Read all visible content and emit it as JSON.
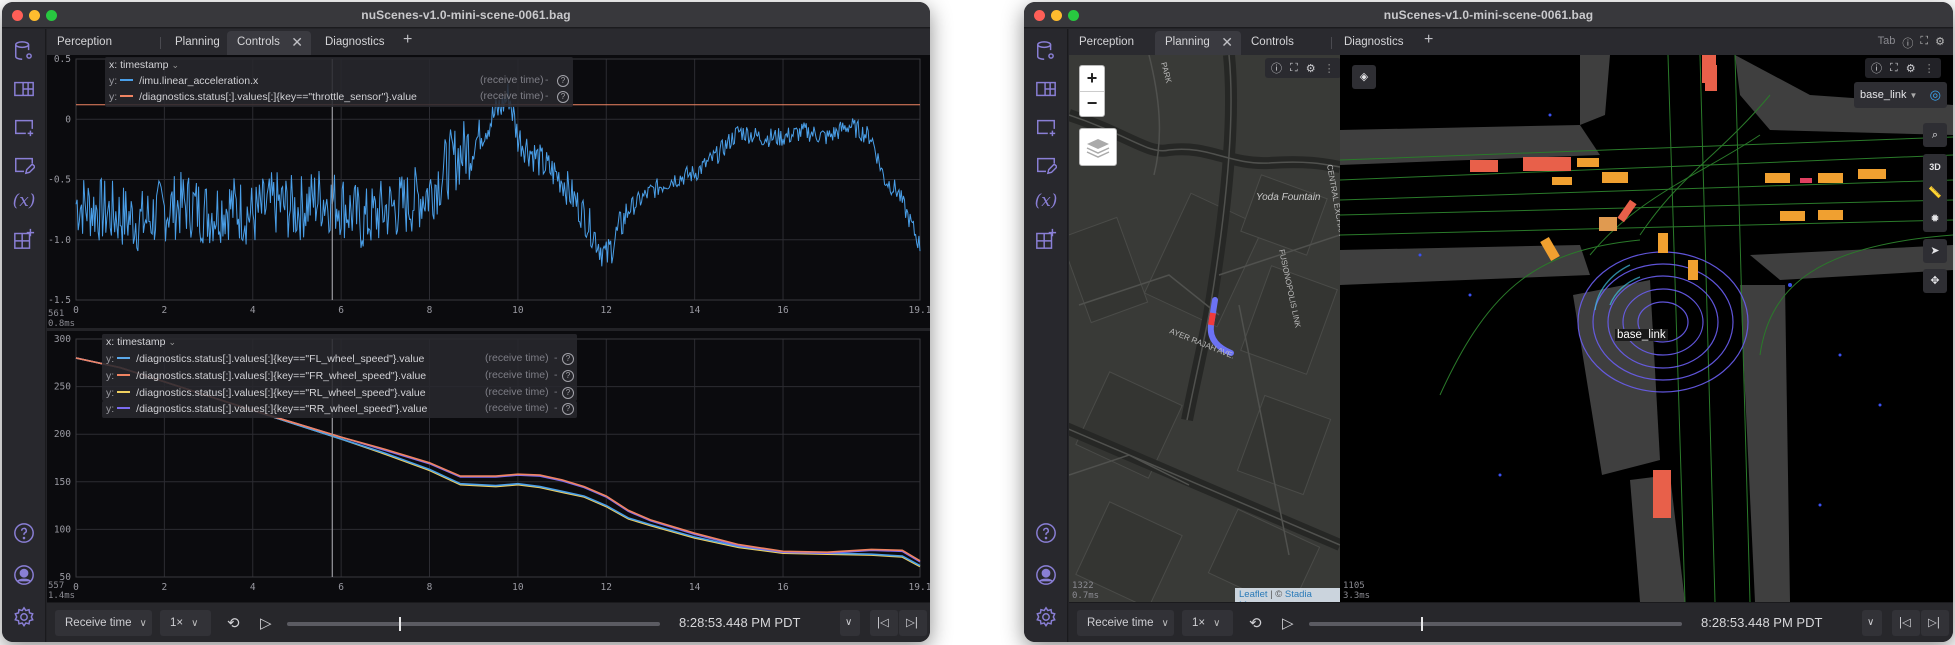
{
  "window_title": "nuScenes-v1.0-mini-scene-0061.bag",
  "sidebar": {
    "top_icons": [
      "data-source-icon",
      "layout-icon",
      "add-panel-icon",
      "edit-panel-icon",
      "variables-icon",
      "extensions-icon"
    ],
    "bottom_icons": [
      "help-icon",
      "user-icon",
      "settings-icon"
    ]
  },
  "left_window": {
    "tabs": [
      {
        "label": "Perception",
        "active": false
      },
      {
        "label": "Planning",
        "active": false
      },
      {
        "label": "Controls",
        "active": true
      },
      {
        "label": "Diagnostics",
        "active": false
      }
    ],
    "plot_top": {
      "x_selector": "x: timestamp",
      "series": [
        {
          "prefix": "y:",
          "path": "/imu.linear_acceleration.x",
          "time": "(receive time)",
          "color": "#4a9fe8"
        },
        {
          "prefix": "y:",
          "path": "/diagnostics.status[:].values[:]{key==\"throttle_sensor\"}.value",
          "time": "(receive time)",
          "color": "#f08462"
        }
      ],
      "dash": "-",
      "help": "?",
      "stat_count": "561",
      "stat_time": "0.8ms"
    },
    "plot_bottom": {
      "x_selector": "x: timestamp",
      "series": [
        {
          "prefix": "y:",
          "path": "/diagnostics.status[:].values[:]{key==\"FL_wheel_speed\"}.value",
          "time": "(receive time)",
          "color": "#5ba8e8"
        },
        {
          "prefix": "y:",
          "path": "/diagnostics.status[:].values[:]{key==\"FR_wheel_speed\"}.value",
          "time": "(receive time)",
          "color": "#f08462"
        },
        {
          "prefix": "y:",
          "path": "/diagnostics.status[:].values[:]{key==\"RL_wheel_speed\"}.value",
          "time": "(receive time)",
          "color": "#f0d060"
        },
        {
          "prefix": "y:",
          "path": "/diagnostics.status[:].values[:]{key==\"RR_wheel_speed\"}.value",
          "time": "(receive time)",
          "color": "#7b6cf0"
        }
      ],
      "dash": "-",
      "help": "?",
      "stat_count": "557",
      "stat_time": "1.4ms"
    },
    "playback": {
      "time_mode": "Receive time",
      "speed": "1×",
      "progress": 0.3,
      "timestamp": "8:28:53.448 PM PDT"
    }
  },
  "right_window": {
    "tabs": [
      {
        "label": "Perception",
        "active": false
      },
      {
        "label": "Planning",
        "active": true
      },
      {
        "label": "Controls",
        "active": false
      },
      {
        "label": "Diagnostics",
        "active": false
      }
    ],
    "tab_toolbar_label": "Tab",
    "map": {
      "zoom_in": "+",
      "zoom_out": "−",
      "labels": [
        "PARK",
        "Yoda Fountain",
        "FUSIONOPOLIS LINK",
        "AYER RAJAH AVE.",
        "CENTRAL EXCHANGE GREEN"
      ],
      "attribution_leaflet": "Leaflet",
      "attribution_sep": " | © ",
      "attribution_stadia": "Stadia Maps",
      "stat_count": "1322",
      "stat_time": "0.7ms"
    },
    "scene3d": {
      "frame_selector": "base_link",
      "frame_label": "base_link",
      "toolbar": [
        "search-icon",
        "3D",
        "ruler-icon",
        "bug-icon",
        "select-icon",
        "pan-icon"
      ],
      "mode_3d": "3D",
      "stat_count": "1105",
      "stat_time": "3.3ms"
    },
    "playback": {
      "time_mode": "Receive time",
      "speed": "1×",
      "progress": 0.3,
      "timestamp": "8:28:53.448 PM PDT"
    }
  },
  "chart_data": [
    {
      "type": "line",
      "title": "",
      "xlabel": "timestamp",
      "ylabel": "",
      "xlim": [
        0,
        19.1
      ],
      "ylim": [
        -1.5,
        0.5
      ],
      "x_ticks": [
        "0",
        "2",
        "4",
        "6",
        "8",
        "10",
        "12",
        "14",
        "16",
        "19.1"
      ],
      "y_ticks": [
        "0.5",
        "0",
        "-0.5",
        "-1.0",
        "-1.5"
      ],
      "cursor_x": 5.8,
      "series": [
        {
          "name": "/imu.linear_acceleration.x",
          "x": [
            0,
            0.5,
            1,
            1.5,
            2,
            2.5,
            3,
            3.5,
            4,
            4.5,
            5,
            5.5,
            6,
            6.5,
            7,
            7.5,
            8,
            8.5,
            9,
            9.5,
            9.8,
            10,
            10.5,
            11,
            11.5,
            12,
            12.5,
            13,
            13.5,
            14,
            14.5,
            15,
            15.5,
            16,
            16.5,
            17,
            17.5,
            18,
            18.3,
            18.6,
            19.1
          ],
          "y": [
            -0.7,
            -0.75,
            -0.8,
            -0.85,
            -0.75,
            -0.7,
            -0.78,
            -0.72,
            -0.8,
            -0.7,
            -0.75,
            -0.65,
            -0.7,
            -0.85,
            -0.75,
            -0.7,
            -0.6,
            -0.35,
            -0.2,
            0.05,
            0.2,
            -0.15,
            -0.35,
            -0.5,
            -0.8,
            -1.15,
            -0.75,
            -0.6,
            -0.5,
            -0.45,
            -0.3,
            -0.1,
            -0.15,
            -0.15,
            -0.1,
            -0.15,
            -0.05,
            -0.15,
            -0.5,
            -0.6,
            -1.05
          ]
        },
        {
          "name": "/diagnostics.status[:].values[:]{key==\"throttle_sensor\"}.value",
          "x": [
            0,
            19.1
          ],
          "y": [
            0.12,
            0.12
          ]
        }
      ]
    },
    {
      "type": "line",
      "title": "",
      "xlabel": "timestamp",
      "ylabel": "",
      "xlim": [
        0,
        19.1
      ],
      "ylim": [
        50,
        300
      ],
      "x_ticks": [
        "0",
        "2",
        "4",
        "6",
        "8",
        "10",
        "12",
        "14",
        "16",
        "19.1"
      ],
      "y_ticks": [
        "300",
        "250",
        "200",
        "150",
        "100",
        "50"
      ],
      "cursor_x": 5.8,
      "series": [
        {
          "name": "FL_wheel_speed",
          "x": [
            0,
            1,
            2,
            3,
            4,
            5,
            6,
            7,
            8,
            8.7,
            9.5,
            10,
            10.5,
            11,
            11.5,
            12,
            12.5,
            13,
            14,
            15,
            16,
            17,
            18,
            18.7,
            19.1
          ],
          "y": [
            280,
            270,
            255,
            240,
            225,
            210,
            195,
            180,
            163,
            148,
            146,
            148,
            145,
            140,
            135,
            125,
            112,
            105,
            92,
            82,
            76,
            75,
            74,
            72,
            62
          ]
        },
        {
          "name": "FR_wheel_speed",
          "x": [
            0,
            1,
            2,
            3,
            4,
            5,
            6,
            7,
            8,
            8.7,
            9.5,
            10,
            10.5,
            11,
            11.5,
            12,
            12.5,
            13,
            14,
            15,
            16,
            17,
            18,
            18.7,
            19.1
          ],
          "y": [
            280,
            270,
            255,
            240,
            225,
            211,
            197,
            184,
            170,
            156,
            156,
            158,
            157,
            152,
            145,
            135,
            120,
            110,
            96,
            84,
            77,
            76,
            79,
            78,
            67
          ]
        },
        {
          "name": "RL_wheel_speed",
          "x": [
            0,
            1,
            2,
            3,
            4,
            5,
            6,
            7,
            8,
            8.7,
            9.5,
            10,
            10.5,
            11,
            11.5,
            12,
            12.5,
            13,
            14,
            15,
            16,
            17,
            18,
            18.7,
            19.1
          ],
          "y": [
            280,
            270,
            255,
            240,
            225,
            210,
            195,
            179,
            162,
            147,
            145,
            147,
            144,
            139,
            134,
            124,
            111,
            104,
            91,
            81,
            75,
            74,
            73,
            71,
            61
          ]
        },
        {
          "name": "RR_wheel_speed",
          "x": [
            0,
            1,
            2,
            3,
            4,
            5,
            6,
            7,
            8,
            8.7,
            9.5,
            10,
            10.5,
            11,
            11.5,
            12,
            12.5,
            13,
            14,
            15,
            16,
            17,
            18,
            18.7,
            19.1
          ],
          "y": [
            280,
            270,
            255,
            240,
            225,
            211,
            197,
            183,
            169,
            155,
            155,
            157,
            156,
            151,
            144,
            134,
            119,
            109,
            95,
            83,
            76,
            75,
            78,
            77,
            66
          ]
        }
      ]
    }
  ]
}
